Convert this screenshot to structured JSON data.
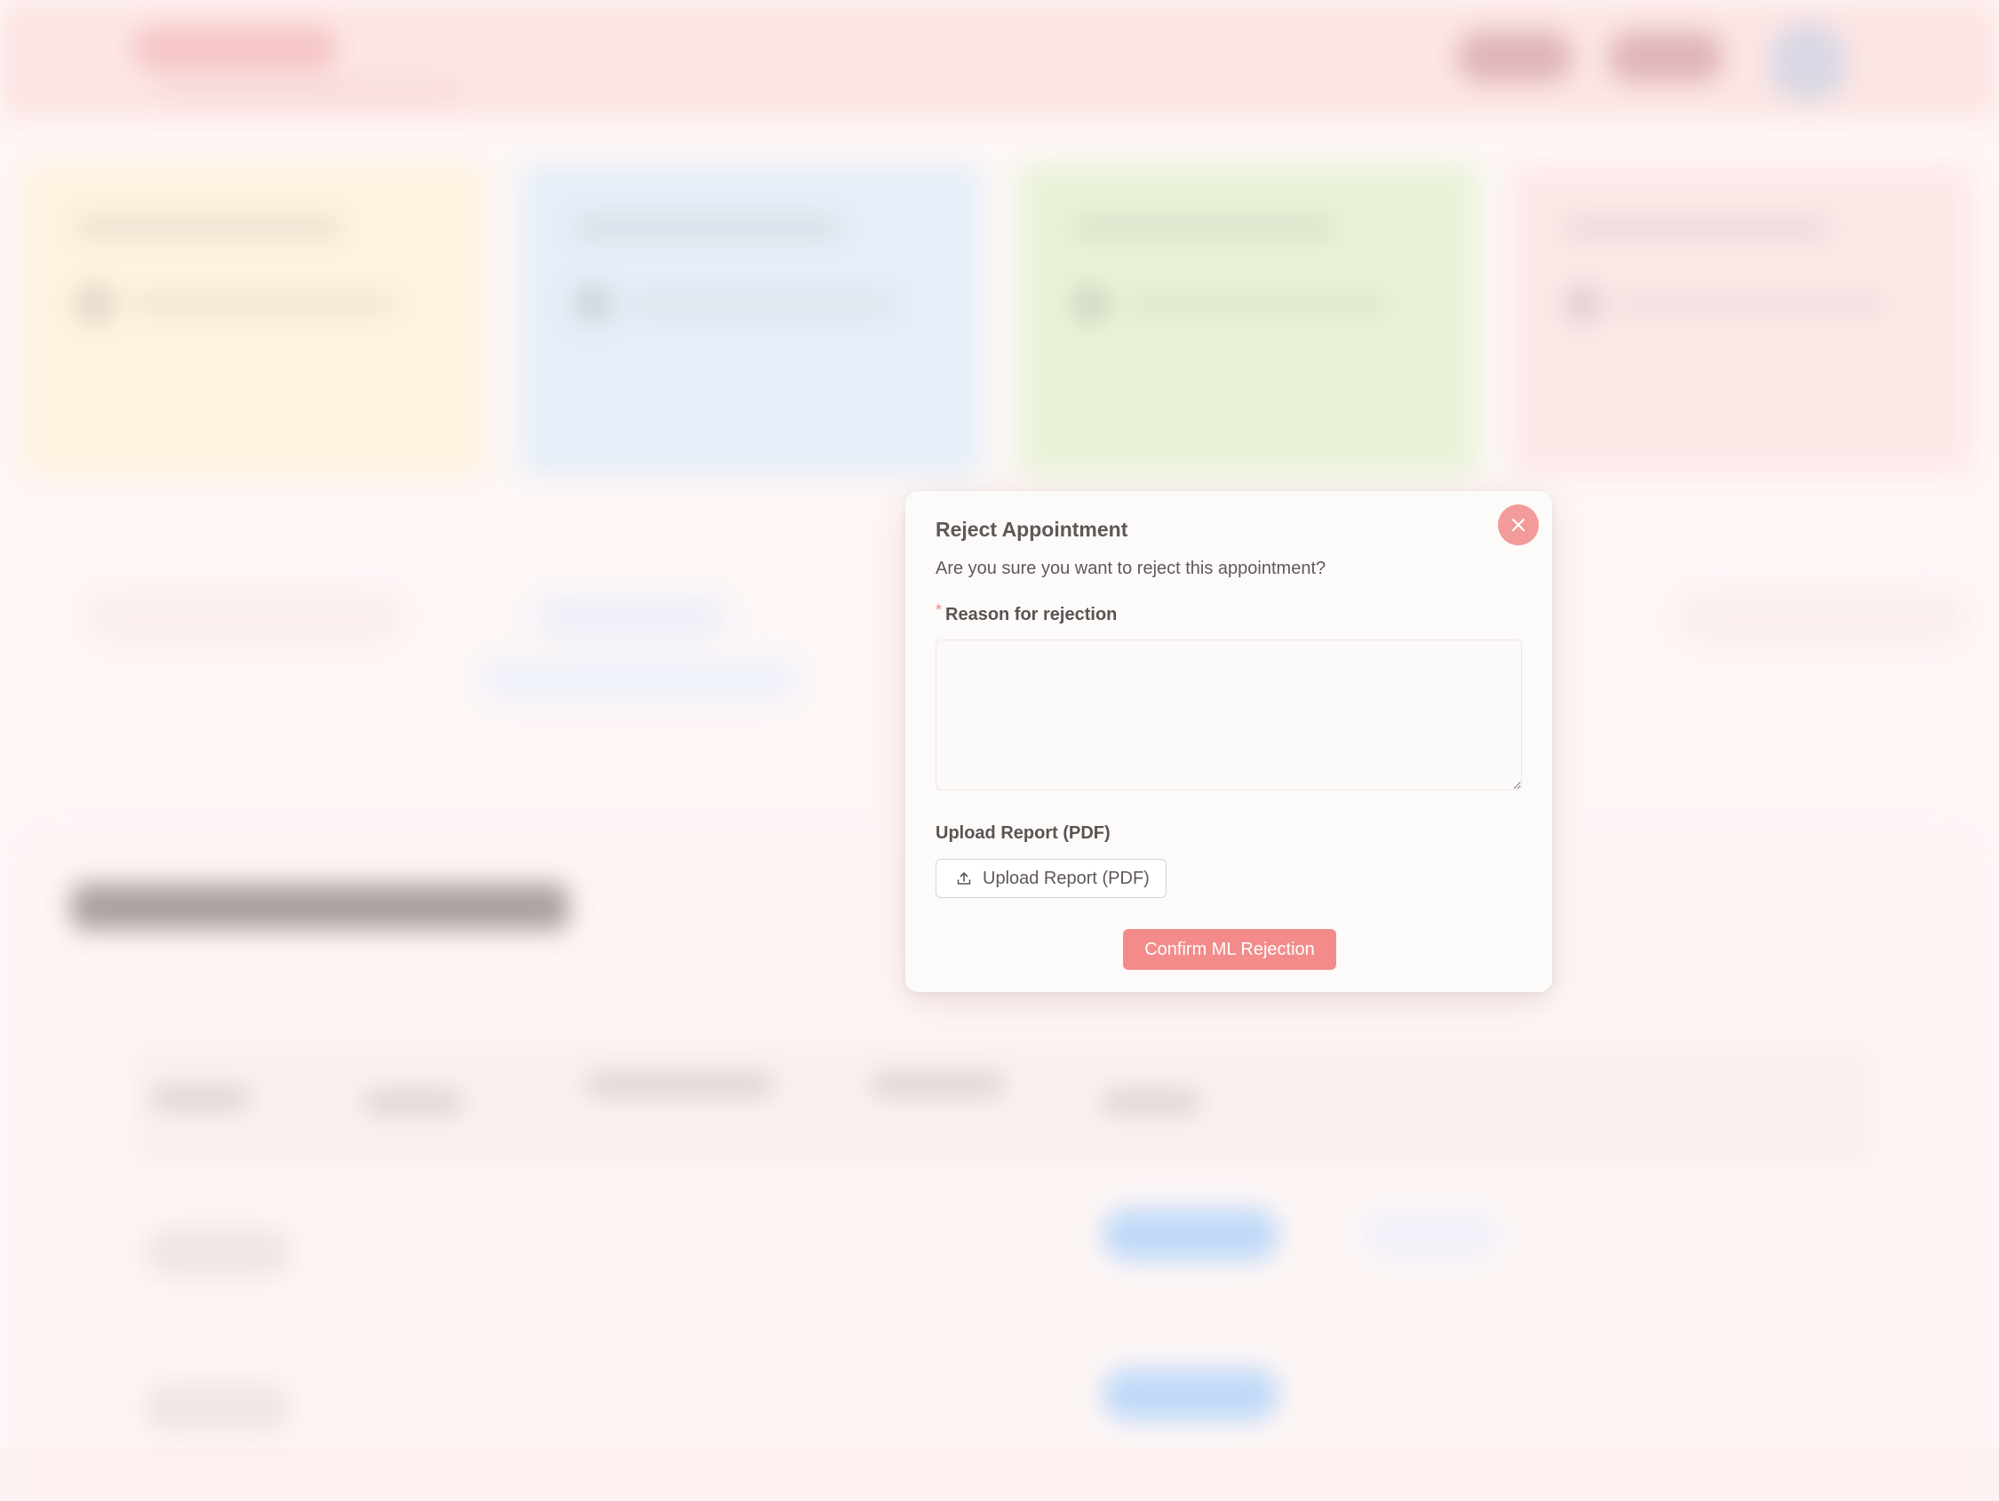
{
  "modal": {
    "title": "Reject Appointment",
    "subtitle": "Are you sure you want to reject this appointment?",
    "required_marker": "*",
    "reason_label": "Reason for rejection",
    "reason_value": "",
    "upload_label": "Upload Report (PDF)",
    "upload_button_label": "Upload Report (PDF)",
    "confirm_button_label": "Confirm ML Rejection",
    "close_icon": "close-icon",
    "upload_icon": "upload-icon"
  },
  "colors": {
    "accent": "#f48b8b",
    "close_button": "#f39a9a",
    "stat_card_1": "#feeccf",
    "stat_card_2": "#d9e6f4",
    "stat_card_3": "#deecc4",
    "stat_card_4": "#fcdcdc"
  }
}
